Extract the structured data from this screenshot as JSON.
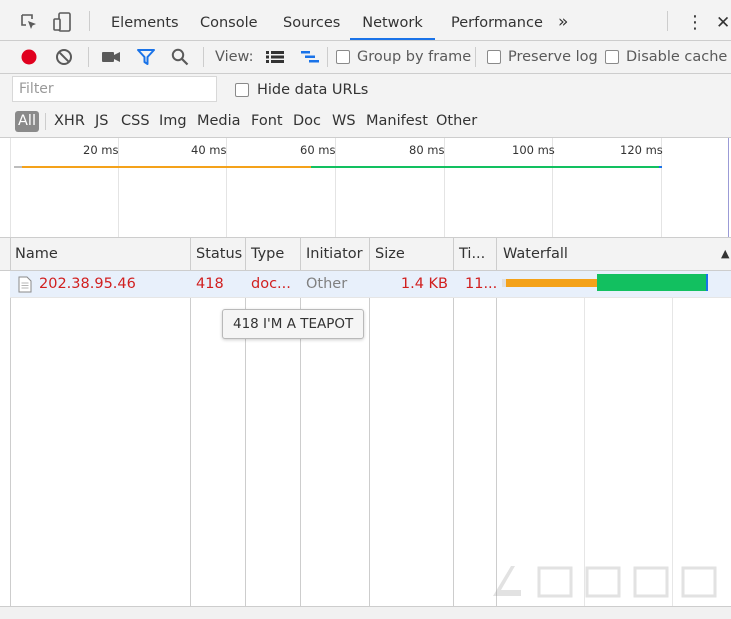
{
  "tabs": [
    {
      "label": "Elements",
      "active": false
    },
    {
      "label": "Console",
      "active": false
    },
    {
      "label": "Sources",
      "active": false
    },
    {
      "label": "Network",
      "active": true
    },
    {
      "label": "Performance",
      "active": false
    }
  ],
  "more_tabs_symbol": "»",
  "kebab_symbol": "⋮",
  "close_symbol": "✕",
  "toolbar": {
    "view_label": "View:",
    "group_by_frame": "Group by frame",
    "preserve_log": "Preserve log",
    "disable_cache": "Disable cache"
  },
  "filter": {
    "placeholder": "Filter",
    "hide_data_urls": "Hide data URLs"
  },
  "type_filters": [
    "All",
    "XHR",
    "JS",
    "CSS",
    "Img",
    "Media",
    "Font",
    "Doc",
    "WS",
    "Manifest",
    "Other"
  ],
  "overview": {
    "ticks": [
      "20 ms",
      "40 ms",
      "60 ms",
      "80 ms",
      "100 ms",
      "120 ms"
    ]
  },
  "columns": {
    "name": "Name",
    "status": "Status",
    "type": "Type",
    "initiator": "Initiator",
    "size": "Size",
    "time": "Ti...",
    "waterfall": "Waterfall",
    "sort_arrow": "▲"
  },
  "rows": [
    {
      "name": "202.38.95.46",
      "status": "418",
      "type": "doc...",
      "initiator": "Other",
      "size": "1.4 KB",
      "time": "11..."
    }
  ],
  "tooltip": "418 I'M A TEAPOT",
  "colors": {
    "record": "#e0001e",
    "accent": "#1a73e8",
    "waiting": "#f4a21a",
    "download": "#12c060",
    "error_text": "#d11f1f"
  }
}
